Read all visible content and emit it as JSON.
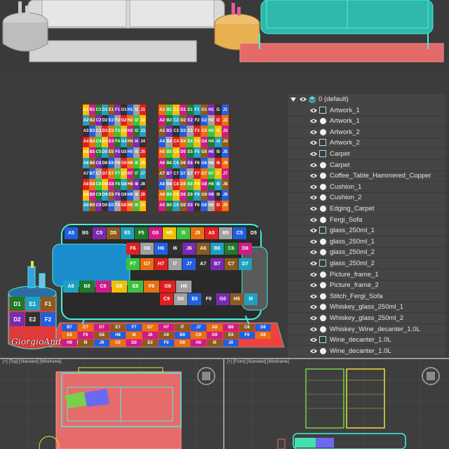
{
  "layers": {
    "header": "0 (default)",
    "items": [
      {
        "label": "Artwork_1",
        "type": "object"
      },
      {
        "label": "Artwork_1",
        "type": "dot"
      },
      {
        "label": "Artwork_2",
        "type": "dot"
      },
      {
        "label": "Artwork_2",
        "type": "object"
      },
      {
        "label": "Carpet",
        "type": "object"
      },
      {
        "label": "Carpet",
        "type": "dot"
      },
      {
        "label": "Coffee_Table_Hammered_Copper",
        "type": "dot"
      },
      {
        "label": "Cushion_1",
        "type": "dot"
      },
      {
        "label": "Cushion_2",
        "type": "dot"
      },
      {
        "label": "Edging_Carpet",
        "type": "dot"
      },
      {
        "label": "Fergi_Sofa",
        "type": "dot"
      },
      {
        "label": "glass_250ml_1",
        "type": "object"
      },
      {
        "label": "glass_250ml_1",
        "type": "dot"
      },
      {
        "label": "glass_250ml_2",
        "type": "dot"
      },
      {
        "label": "glass_250ml_2",
        "type": "object"
      },
      {
        "label": "Picture_frame_1",
        "type": "dot"
      },
      {
        "label": "Picture_frame_2",
        "type": "dot"
      },
      {
        "label": "Stitch_Fergi_Sofa",
        "type": "dot"
      },
      {
        "label": "Whiskey_glass_250ml_1",
        "type": "dot"
      },
      {
        "label": "Whiskey_glass_250ml_2",
        "type": "dot"
      },
      {
        "label": "Whiskey_Wine_decanter_1.0L",
        "type": "dot"
      },
      {
        "label": "Wine_decanter_1.0L",
        "type": "object"
      },
      {
        "label": "Wine_decanter_1.0L",
        "type": "dot"
      }
    ]
  },
  "viewports": {
    "top_label": "[+] [Top] [Standard] [Wireframe]",
    "front_label": "[+] [Front] [Standard] [Wireframe]"
  },
  "watermark": "GiorgioAndriani",
  "texture_rows": [
    "A",
    "B",
    "C",
    "D",
    "E",
    "F",
    "G",
    "H",
    "I",
    "J"
  ],
  "sofa_labels": {
    "back": [
      "A5",
      "B5",
      "C5",
      "D5",
      "E5",
      "F5",
      "G5",
      "H5",
      "I5",
      "J5",
      "A5",
      "B5",
      "C5",
      "D5"
    ],
    "back2": [
      "F6",
      "G6",
      "H6",
      "I6",
      "J6",
      "A6",
      "B6",
      "C6",
      "D6"
    ],
    "back3": [
      "F7",
      "G7",
      "H7",
      "I7",
      "J7",
      "A7",
      "B7",
      "C7",
      "D7"
    ],
    "seat": [
      "A8",
      "B8",
      "C8",
      "D8",
      "E8",
      "F8",
      "G8",
      "H8"
    ],
    "seat2": [
      "C9",
      "D0",
      "E0",
      "F0",
      "G0",
      "H0",
      "I0"
    ],
    "table": [
      "D1",
      "E1",
      "F1",
      "D2",
      "E2",
      "F2"
    ],
    "carpet": [
      "B7",
      "C7",
      "D7",
      "E7",
      "F7",
      "G7",
      "H7",
      "I7",
      "J7",
      "A8",
      "B8",
      "C8",
      "D8",
      "E8",
      "F8",
      "G8",
      "H8",
      "I8",
      "J8",
      "A9",
      "B9",
      "C9",
      "D9",
      "E9",
      "F9",
      "G9",
      "H9",
      "I9",
      "J9",
      "C0",
      "D0",
      "E0",
      "F0",
      "G0",
      "H0",
      "I0",
      "J0"
    ]
  },
  "colors": {
    "wire_cyan": "#33e6d0",
    "selection_red": "#e86b6b",
    "frame_yellow": "#e8e040"
  }
}
